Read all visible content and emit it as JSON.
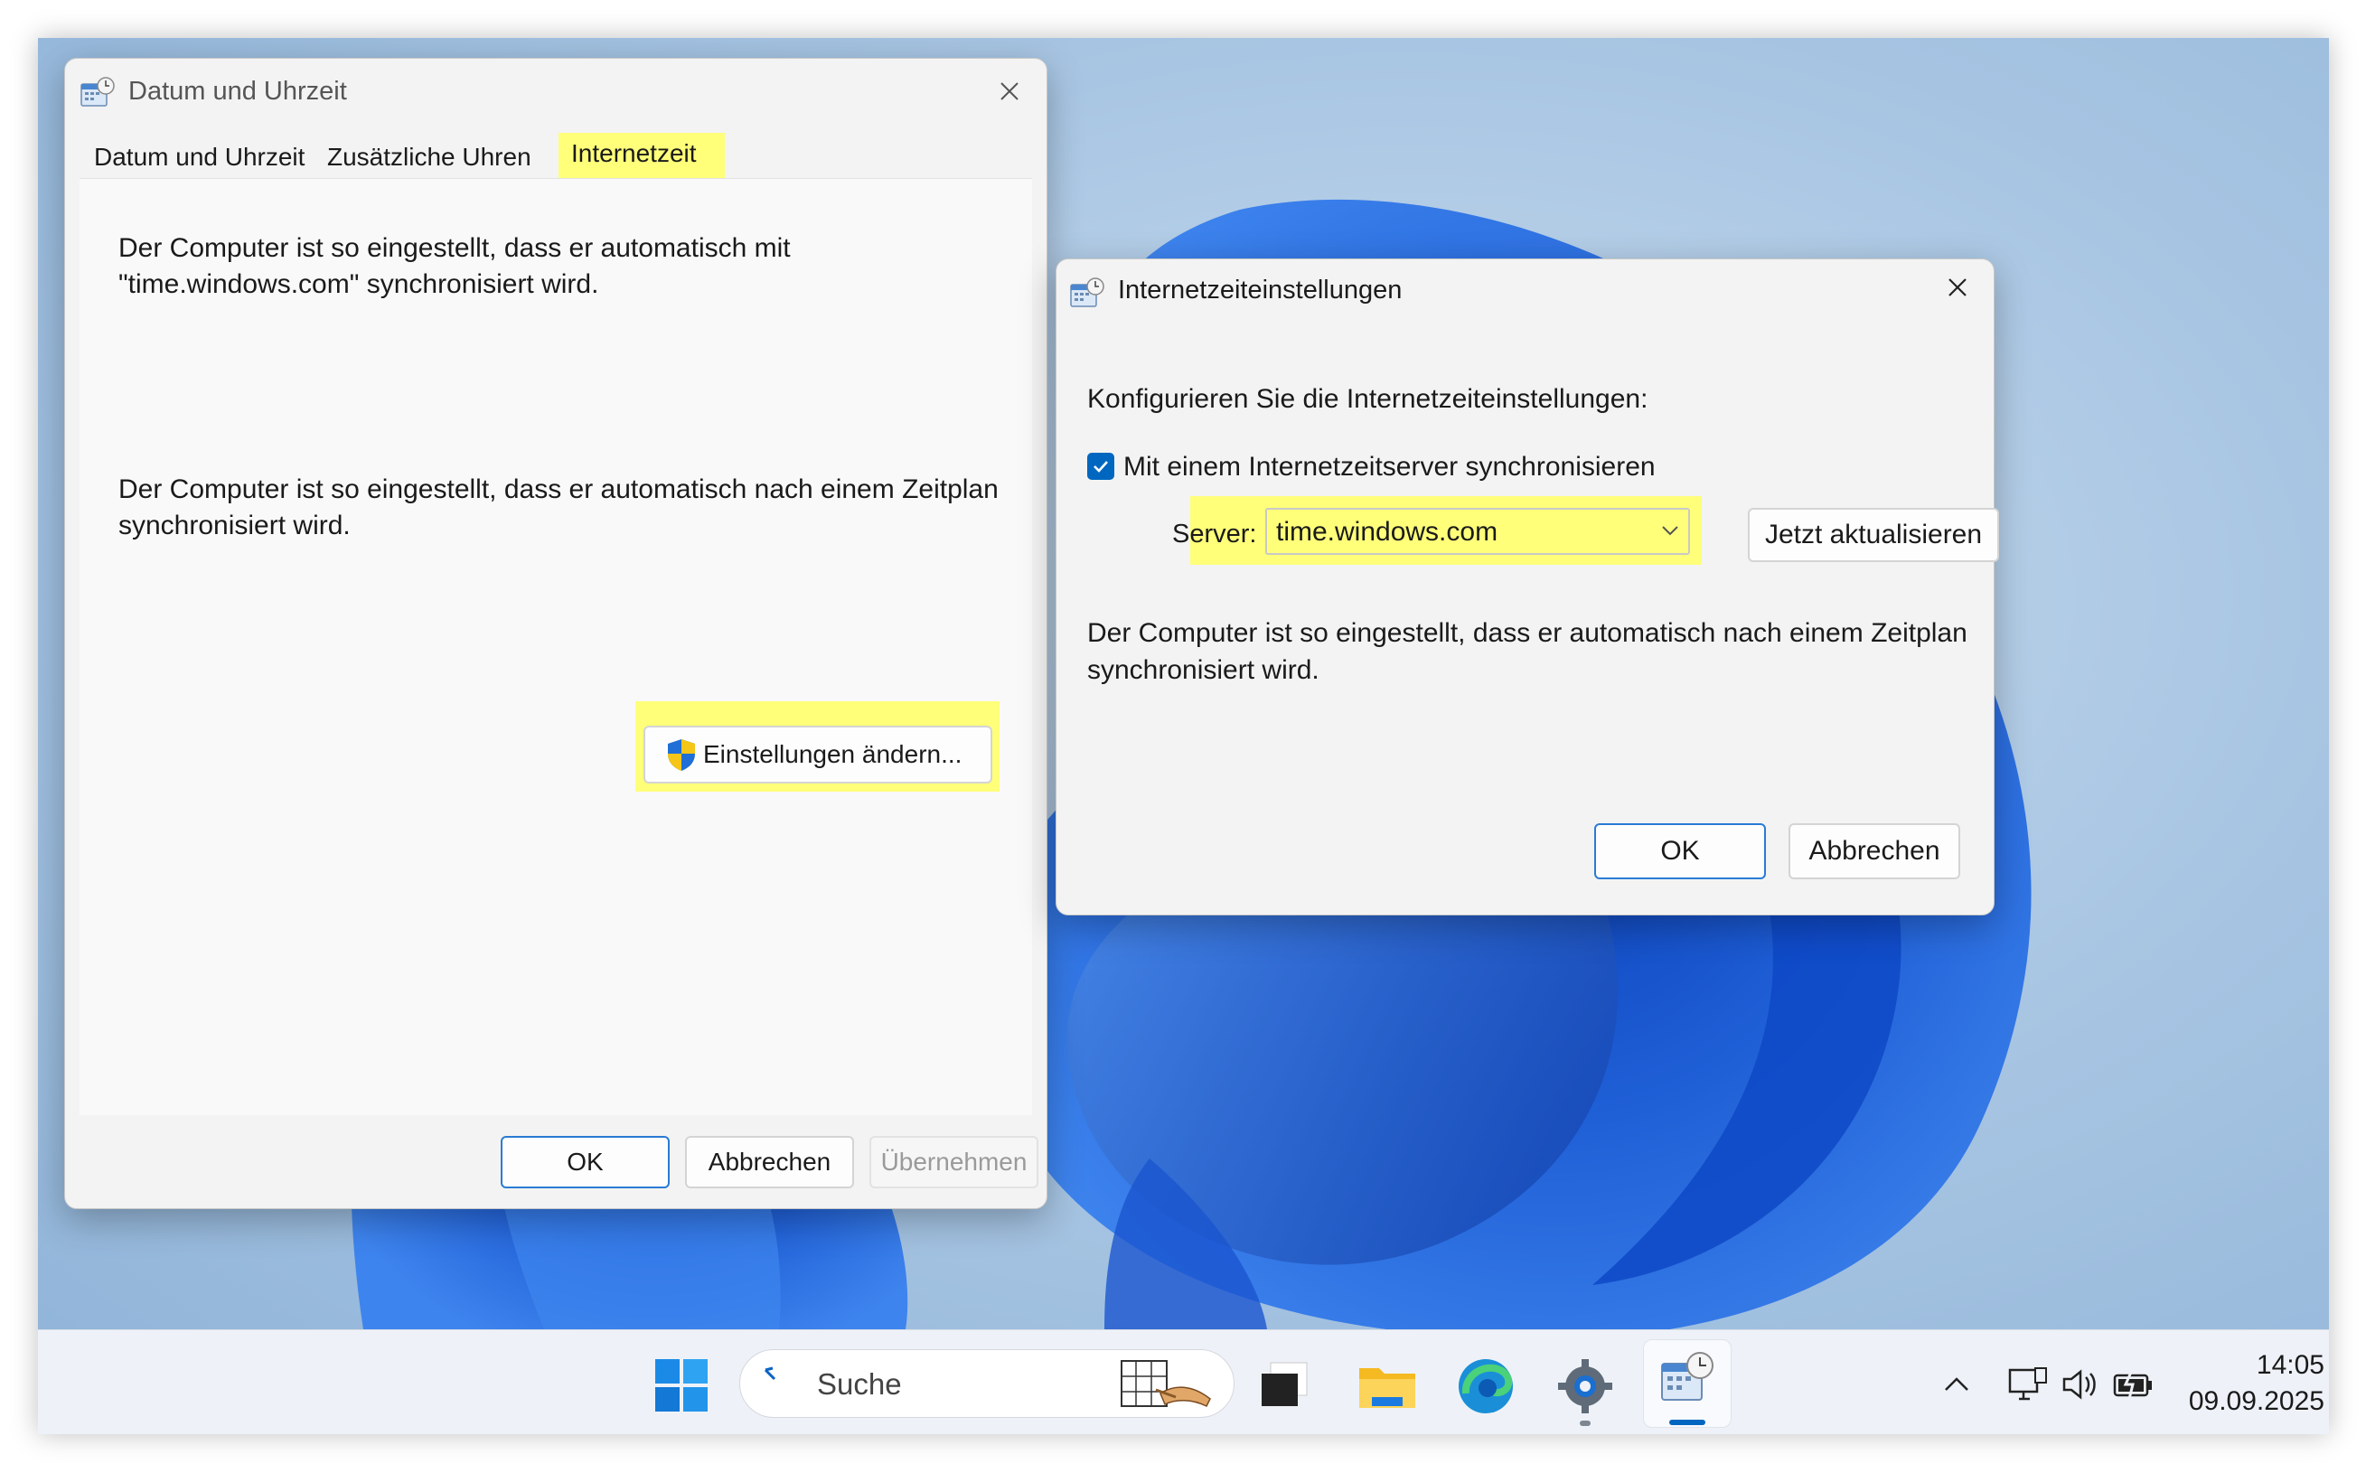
{
  "window1": {
    "title": "Datum und Uhrzeit",
    "tabs": [
      {
        "label": "Datum und Uhrzeit"
      },
      {
        "label": "Zusätzliche Uhren"
      },
      {
        "label": "Internetzeit"
      }
    ],
    "text1_line1": "Der Computer ist so eingestellt, dass er automatisch mit",
    "text1_line2": "\"time.windows.com\" synchronisiert wird.",
    "text2_line1": "Der Computer ist so eingestellt, dass er automatisch nach einem Zeitplan",
    "text2_line2": "synchronisiert wird.",
    "change_settings_label": "Einstellungen ändern...",
    "ok_label": "OK",
    "cancel_label": "Abbrechen",
    "apply_label": "Übernehmen"
  },
  "window2": {
    "title": "Internetzeiteinstellungen",
    "configure_label": "Konfigurieren Sie die Internetzeiteinstellungen:",
    "sync_checkbox_label": "Mit einem Internetzeitserver synchronisieren",
    "sync_checked": true,
    "server_label": "Server:",
    "server_value": "time.windows.com",
    "update_now_label": "Jetzt aktualisieren",
    "schedule_line1": "Der Computer ist so eingestellt, dass er automatisch nach einem Zeitplan",
    "schedule_line2": "synchronisiert wird.",
    "ok_label": "OK",
    "cancel_label": "Abbrechen"
  },
  "taskbar": {
    "search_placeholder": "Suche",
    "time": "14:05",
    "date": "09.09.2025"
  },
  "colors": {
    "highlight": "#ffff7a",
    "accent": "#0067c0",
    "wallpaper_blue": "#1f5fd6"
  }
}
